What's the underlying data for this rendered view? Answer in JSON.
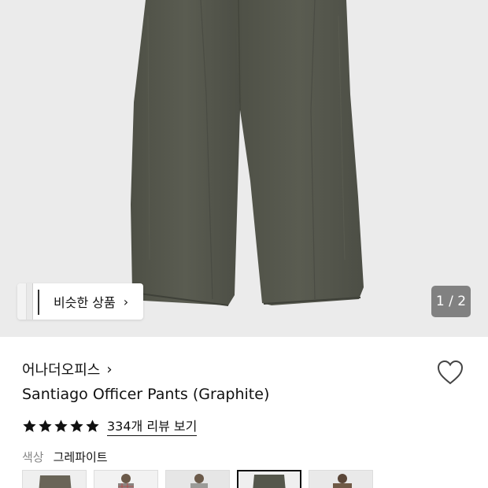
{
  "gallery": {
    "image_alt": "graphite-pants-photo",
    "similar_button_label": "비슷한 상품",
    "page_indicator": "1 / 2"
  },
  "product": {
    "brand": "어나더오피스",
    "title": "Santiago Officer Pants (Graphite)",
    "rating": 5,
    "review_link": "334개 리뷰 보기",
    "color_label": "색상",
    "color_value": "그레파이트"
  },
  "swatches": [
    {
      "name": "graphite-flat",
      "selected": false
    },
    {
      "name": "check-model",
      "selected": false
    },
    {
      "name": "grey-model",
      "selected": false
    },
    {
      "name": "graphite-flat-2",
      "selected": true
    },
    {
      "name": "brown-model",
      "selected": false
    }
  ],
  "colors": {
    "image_bg": "#ebebeb",
    "pants": "#55574c",
    "indicator_bg": "#6e6e6e"
  }
}
